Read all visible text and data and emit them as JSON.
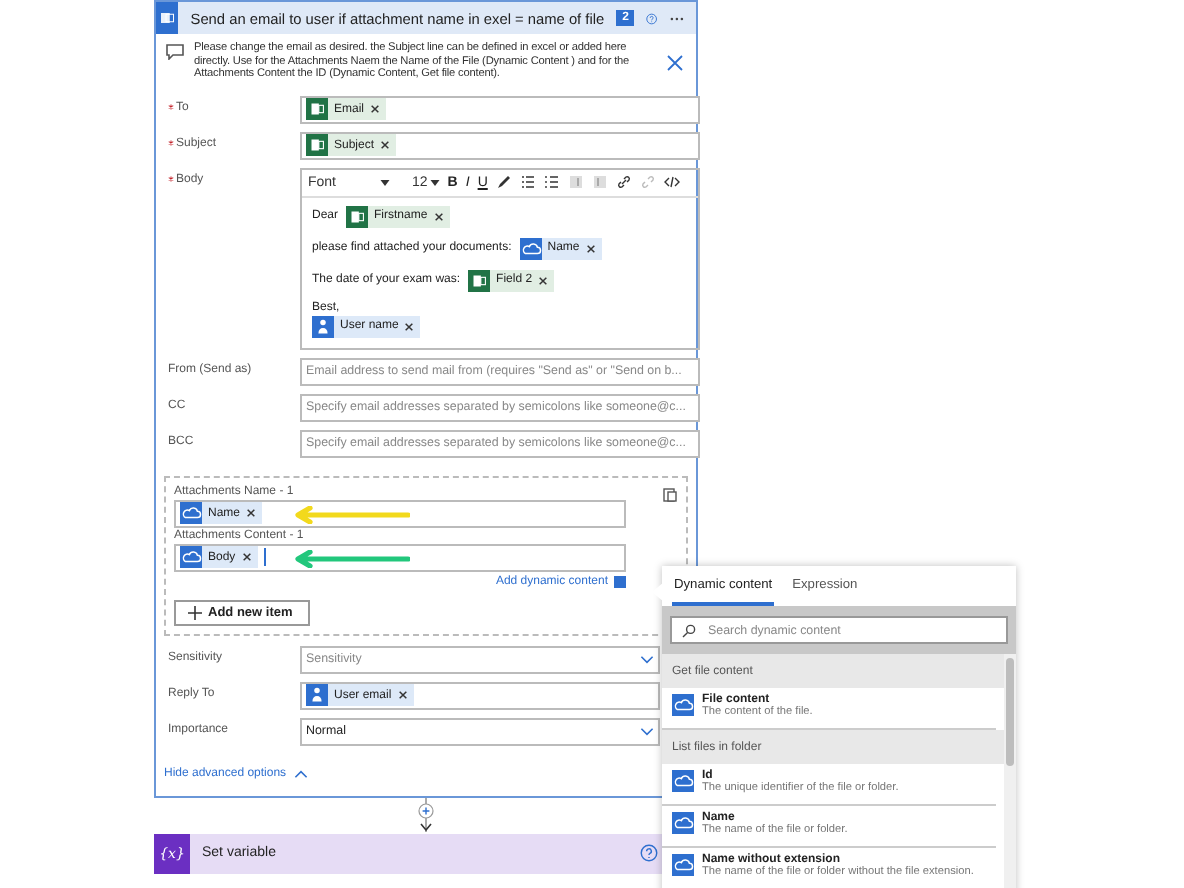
{
  "card": {
    "title": "Send an email to user if attachment name in exel = name of file",
    "badge": "2",
    "note": "Please change the email as desired. the Subject line can be defined in excel or added here directly. Use for the Attachments Naem the Name of the File (Dynamic Content ) and for the Attachments Content the ID (Dynamic Content, Get file content).",
    "top_fields": [
      {
        "label": "To",
        "required": true,
        "tokens": [
          {
            "kind": "excel",
            "text": "Email"
          }
        ]
      },
      {
        "label": "Subject",
        "required": true,
        "tokens": [
          {
            "kind": "excel",
            "text": "Subject"
          }
        ]
      }
    ],
    "body": {
      "label": "Body",
      "required": true,
      "font": "Font",
      "size": "12",
      "format_buttons": [
        "B",
        "I",
        "U"
      ],
      "lines": [
        {
          "kind": "inline",
          "text": "Dear",
          "token": {
            "kind": "excel",
            "text": "Firstname"
          }
        },
        {
          "kind": "inline",
          "text": "please find attached your documents:",
          "token": {
            "kind": "file",
            "text": "Name"
          }
        },
        {
          "kind": "inline",
          "text": "The date of your exam was:",
          "token": {
            "kind": "excel",
            "text": "Field 2"
          }
        },
        {
          "kind": "stacked",
          "text": "Best,",
          "token": {
            "kind": "user",
            "text": "User name"
          }
        }
      ]
    },
    "optional_fields": [
      {
        "label": "From (Send as)",
        "placeholder": "Email address to send mail from (requires \"Send as\" or \"Send on b..."
      },
      {
        "label": "CC",
        "placeholder": "Specify email addresses separated by semicolons like someone@c..."
      },
      {
        "label": "BCC",
        "placeholder": "Specify email addresses separated by semicolons like someone@c..."
      }
    ],
    "attachments": {
      "items": [
        {
          "label": "Attachments Name - 1",
          "tokens": [
            {
              "kind": "file",
              "text": "Name"
            }
          ],
          "cursor": false,
          "color": "#f2d91c"
        },
        {
          "label": "Attachments Content - 1",
          "tokens": [
            {
              "kind": "file",
              "text": "Body"
            }
          ],
          "cursor": true,
          "color": "#22c77c"
        }
      ],
      "add_dynamic": "Add dynamic content",
      "add_item": "Add new item"
    },
    "advanced_fields": [
      {
        "label": "Sensitivity",
        "kind": "dropdown",
        "placeholder": "Sensitivity"
      },
      {
        "label": "Reply To",
        "kind": "tokens",
        "tokens": [
          {
            "kind": "user",
            "text": "User email"
          }
        ]
      },
      {
        "label": "Importance",
        "kind": "dropdown",
        "value": "Normal"
      }
    ],
    "hide_advanced": "Hide advanced options"
  },
  "next_step": {
    "icon": "{x}",
    "title": "Set variable"
  },
  "dynamic_panel": {
    "tabs": [
      {
        "label": "Dynamic content",
        "selected": true
      },
      {
        "label": "Expression",
        "selected": false
      }
    ],
    "search": {
      "placeholder": "Search dynamic content"
    },
    "sections": [
      {
        "title": "Get file content",
        "items": [
          {
            "name": "File content",
            "description": "The content of the file."
          }
        ]
      },
      {
        "title": "List files in folder",
        "items": [
          {
            "name": "Id",
            "description": "The unique identifier of the file or folder."
          },
          {
            "name": "Name",
            "description": "The name of the file or folder."
          },
          {
            "name": "Name without extension",
            "description": "The name of the file or folder without the file extension."
          }
        ]
      }
    ]
  }
}
